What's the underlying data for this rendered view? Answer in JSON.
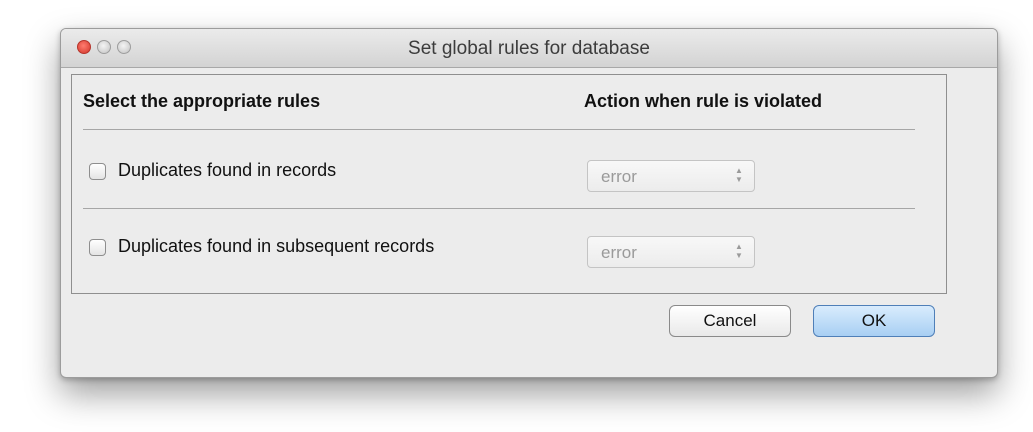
{
  "window": {
    "title": "Set global rules for database"
  },
  "table": {
    "header_rules": "Select the appropriate rules",
    "header_action": "Action when rule is violated",
    "rules": [
      {
        "label": "Duplicates found in records",
        "checked": false,
        "action": "error"
      },
      {
        "label": "Duplicates found in subsequent records",
        "checked": false,
        "action": "error"
      }
    ]
  },
  "buttons": {
    "cancel": "Cancel",
    "ok": "OK"
  }
}
